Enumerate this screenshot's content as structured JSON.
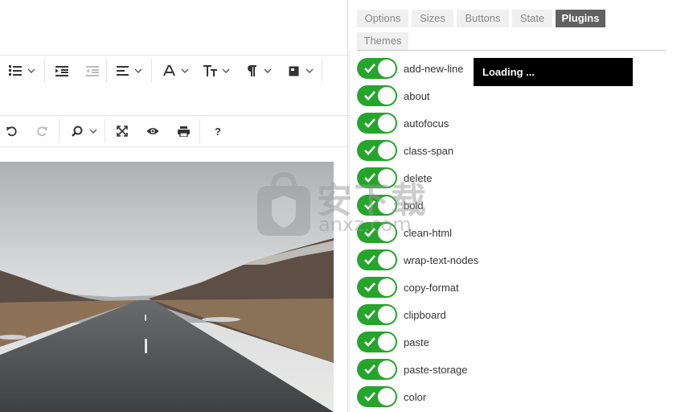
{
  "tabs": [
    {
      "label": "Options",
      "active": false
    },
    {
      "label": "Sizes",
      "active": false
    },
    {
      "label": "Buttons",
      "active": false
    },
    {
      "label": "State",
      "active": false
    },
    {
      "label": "Plugins",
      "active": true
    },
    {
      "label": "Themes",
      "active": false
    }
  ],
  "plugins": [
    {
      "label": "add-new-line",
      "enabled": true
    },
    {
      "label": "about",
      "enabled": true
    },
    {
      "label": "autofocus",
      "enabled": true
    },
    {
      "label": "class-span",
      "enabled": true
    },
    {
      "label": "delete",
      "enabled": true
    },
    {
      "label": "bold",
      "enabled": true
    },
    {
      "label": "clean-html",
      "enabled": true
    },
    {
      "label": "wrap-text-nodes",
      "enabled": true
    },
    {
      "label": "copy-format",
      "enabled": true
    },
    {
      "label": "clipboard",
      "enabled": true
    },
    {
      "label": "paste",
      "enabled": true
    },
    {
      "label": "paste-storage",
      "enabled": true
    },
    {
      "label": "color",
      "enabled": true
    }
  ],
  "loading_text": "Loading ...",
  "toolbar": {
    "row1_icons": [
      "ordered-list-icon",
      "indent-icon",
      "outdent-icon",
      "align-icon",
      "font-icon",
      "font-size-icon",
      "paragraph-icon",
      "image-icon"
    ],
    "row3_icons": [
      "undo-icon",
      "redo-icon",
      "find-icon",
      "fullscreen-icon",
      "preview-icon",
      "print-icon",
      "help-icon"
    ],
    "help_glyph": "?"
  },
  "watermark": {
    "text": "安下载",
    "sub": "anxz.com"
  },
  "colors": {
    "toggle_on": "#25a52b",
    "tab_active_bg": "#616161",
    "tab_bg": "#f0f0f0",
    "loading_bg": "#000000"
  }
}
